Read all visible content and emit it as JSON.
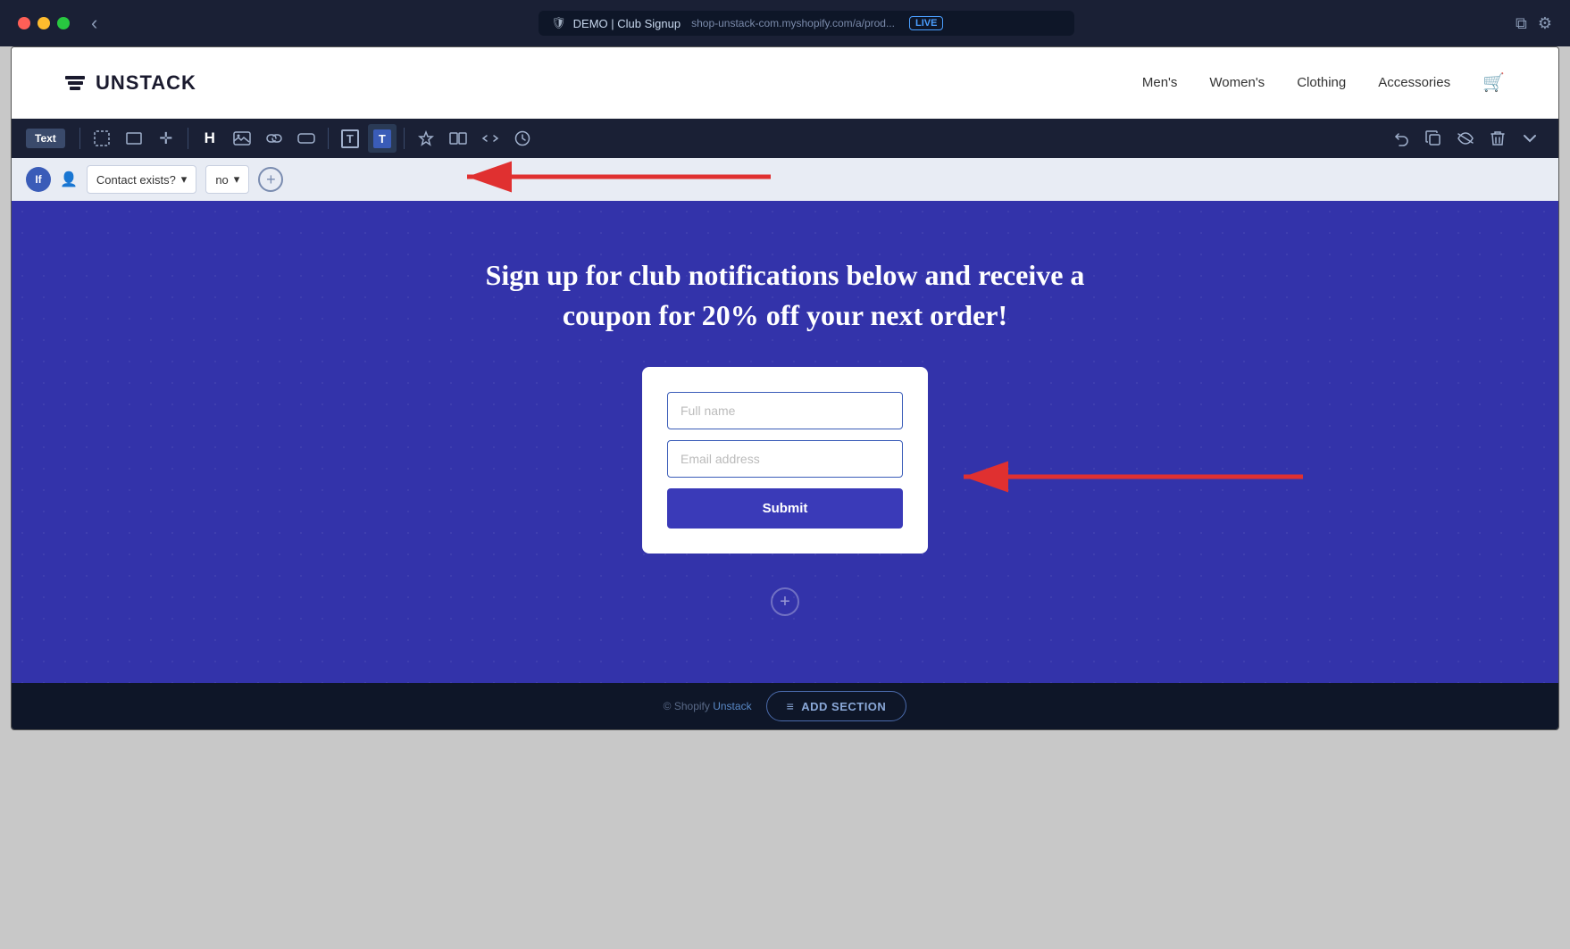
{
  "browser": {
    "traffic_lights": [
      "red",
      "yellow",
      "green"
    ],
    "back_label": "‹",
    "url_icon": "🛡",
    "site_title": "DEMO | Club Signup",
    "url": "shop-unstack-com.myshopify.com/a/prod...",
    "live_label": "LIVE",
    "copy_icon": "⧉",
    "settings_icon": "⚙"
  },
  "site_header": {
    "logo_text": "UNSTACK",
    "nav": [
      {
        "label": "Men's"
      },
      {
        "label": "Women's"
      },
      {
        "label": "Clothing"
      },
      {
        "label": "Accessories"
      }
    ]
  },
  "toolbar": {
    "text_label": "Text",
    "tools": [
      {
        "name": "select-tool",
        "icon": "⊞"
      },
      {
        "name": "frame-tool",
        "icon": "⬚"
      },
      {
        "name": "move-tool",
        "icon": "✛"
      },
      {
        "name": "heading-tool",
        "icon": "H"
      },
      {
        "name": "image-tool",
        "icon": "🖼"
      },
      {
        "name": "link-tool",
        "icon": "◈"
      },
      {
        "name": "button-tool",
        "icon": "▬"
      },
      {
        "name": "text-outline-tool",
        "icon": "T"
      },
      {
        "name": "text-solid-tool",
        "icon": "T"
      },
      {
        "name": "symbol-tool",
        "icon": "⚗"
      },
      {
        "name": "split-tool",
        "icon": "⧉"
      },
      {
        "name": "embed-tool",
        "icon": "↔"
      },
      {
        "name": "clock-tool",
        "icon": "⏱"
      }
    ],
    "right_tools": [
      {
        "name": "undo",
        "icon": "↺"
      },
      {
        "name": "duplicate",
        "icon": "⧉"
      },
      {
        "name": "hide",
        "icon": "👁"
      },
      {
        "name": "delete",
        "icon": "🗑"
      },
      {
        "name": "collapse",
        "icon": "⌄"
      }
    ]
  },
  "condition_bar": {
    "if_label": "If",
    "contact_label": "Contact exists?",
    "condition_value": "no",
    "add_label": "+"
  },
  "hero": {
    "title": "Sign up for club notifications below and receive a coupon for 20% off your next order!",
    "form": {
      "name_placeholder": "Full name",
      "email_placeholder": "Email address",
      "submit_label": "Submit"
    }
  },
  "footer": {
    "text": "© Shopify ",
    "link_text": "Unstack",
    "add_section_label": "ADD SECTION"
  }
}
